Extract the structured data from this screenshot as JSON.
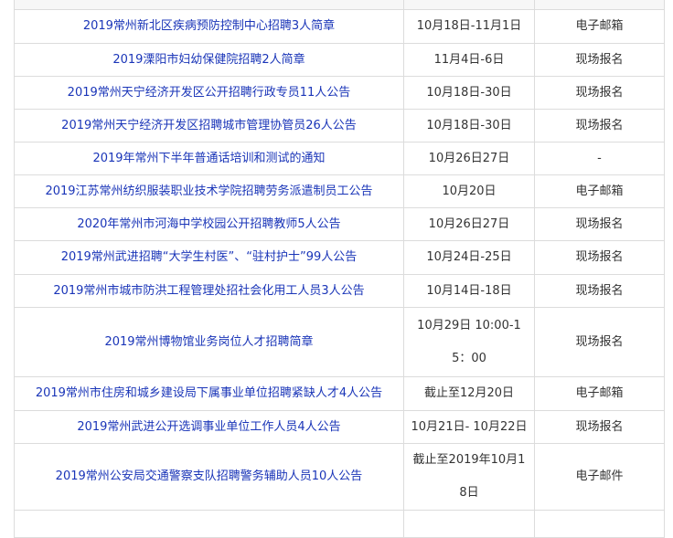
{
  "rows": [
    {
      "title": "",
      "date": "",
      "method": ""
    },
    {
      "title": "2019常州新北区疾病预防控制中心招聘3人简章",
      "date": "10月18日-11月1日",
      "method": "电子邮箱"
    },
    {
      "title": "2019溧阳市妇幼保健院招聘2人简章",
      "date": "11月4日-6日",
      "method": "现场报名"
    },
    {
      "title": "2019常州天宁经济开发区公开招聘行政专员11人公告",
      "date": "10月18日-30日",
      "method": "现场报名"
    },
    {
      "title": "2019常州天宁经济开发区招聘城市管理协管员26人公告",
      "date": "10月18日-30日",
      "method": "现场报名"
    },
    {
      "title": "2019年常州下半年普通话培训和测试的通知",
      "date": "10月26日27日",
      "method": "-"
    },
    {
      "title": "2019江苏常州纺织服装职业技术学院招聘劳务派遣制员工公告",
      "date": "10月20日",
      "method": "电子邮箱"
    },
    {
      "title": "2020年常州市河海中学校园公开招聘教师5人公告",
      "date": "10月26日27日",
      "method": "现场报名"
    },
    {
      "title": "2019常州武进招聘“大学生村医”、“驻村护士”99人公告",
      "date": "10月24日-25日",
      "method": "现场报名"
    },
    {
      "title": "2019常州市城市防洪工程管理处招社会化用工人员3人公告",
      "date": "10月14日-18日",
      "method": "现场报名"
    },
    {
      "title": "2019常州博物馆业务岗位人才招聘简章",
      "date": "10月29日 10:00-15：00",
      "method": "现场报名"
    },
    {
      "title": "2019常州市住房和城乡建设局下属事业单位招聘紧缺人才4人公告",
      "date": "截止至12月20日",
      "method": "电子邮箱"
    },
    {
      "title": "2019常州武进公开选调事业单位工作人员4人公告",
      "date": "10月21日- 10月22日",
      "method": "现场报名"
    },
    {
      "title": "2019常州公安局交通警察支队招聘警务辅助人员10人公告",
      "date": "截止至2019年10月18日",
      "method": "电子邮件"
    },
    {
      "title": "",
      "date": "",
      "method": ""
    }
  ]
}
